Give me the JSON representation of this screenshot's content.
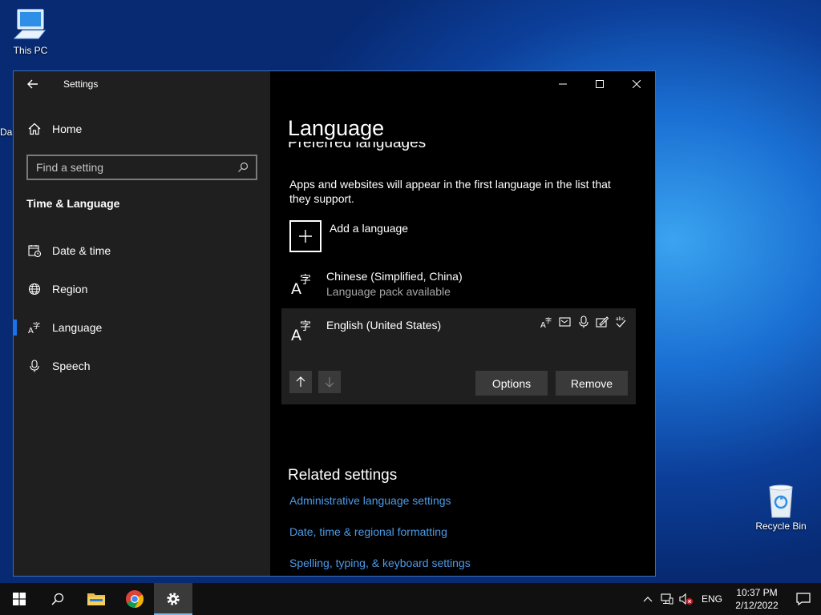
{
  "desktop": {
    "this_pc_label": "This PC",
    "recycle_bin_label": "Recycle Bin",
    "left_edge_fragment": "Da"
  },
  "window": {
    "title": "Settings",
    "back_icon": "arrow-left-icon",
    "accent_color": "#1a73e8"
  },
  "sidebar": {
    "home_label": "Home",
    "search_placeholder": "Find a setting",
    "section_title": "Time & Language",
    "items": [
      {
        "label": "Date & time",
        "icon": "calendar-clock-icon"
      },
      {
        "label": "Region",
        "icon": "globe-icon"
      },
      {
        "label": "Language",
        "icon": "language-icon",
        "selected": true
      },
      {
        "label": "Speech",
        "icon": "microphone-icon"
      }
    ]
  },
  "main": {
    "page_title": "Language",
    "subheading": "Preferred languages",
    "description": "Apps and websites will appear in the first language in the list that they support.",
    "add_language_label": "Add a language",
    "languages": [
      {
        "name": "Chinese (Simplified, China)",
        "status": "Language pack available"
      },
      {
        "name": "English (United States)",
        "status": ""
      }
    ],
    "options_label": "Options",
    "remove_label": "Remove",
    "related_title": "Related settings",
    "links": [
      "Administrative language settings",
      "Date, time & regional formatting",
      "Spelling, typing, & keyboard settings"
    ]
  },
  "taskbar": {
    "language_indicator": "ENG",
    "time": "10:37 PM",
    "date": "2/12/2022"
  }
}
